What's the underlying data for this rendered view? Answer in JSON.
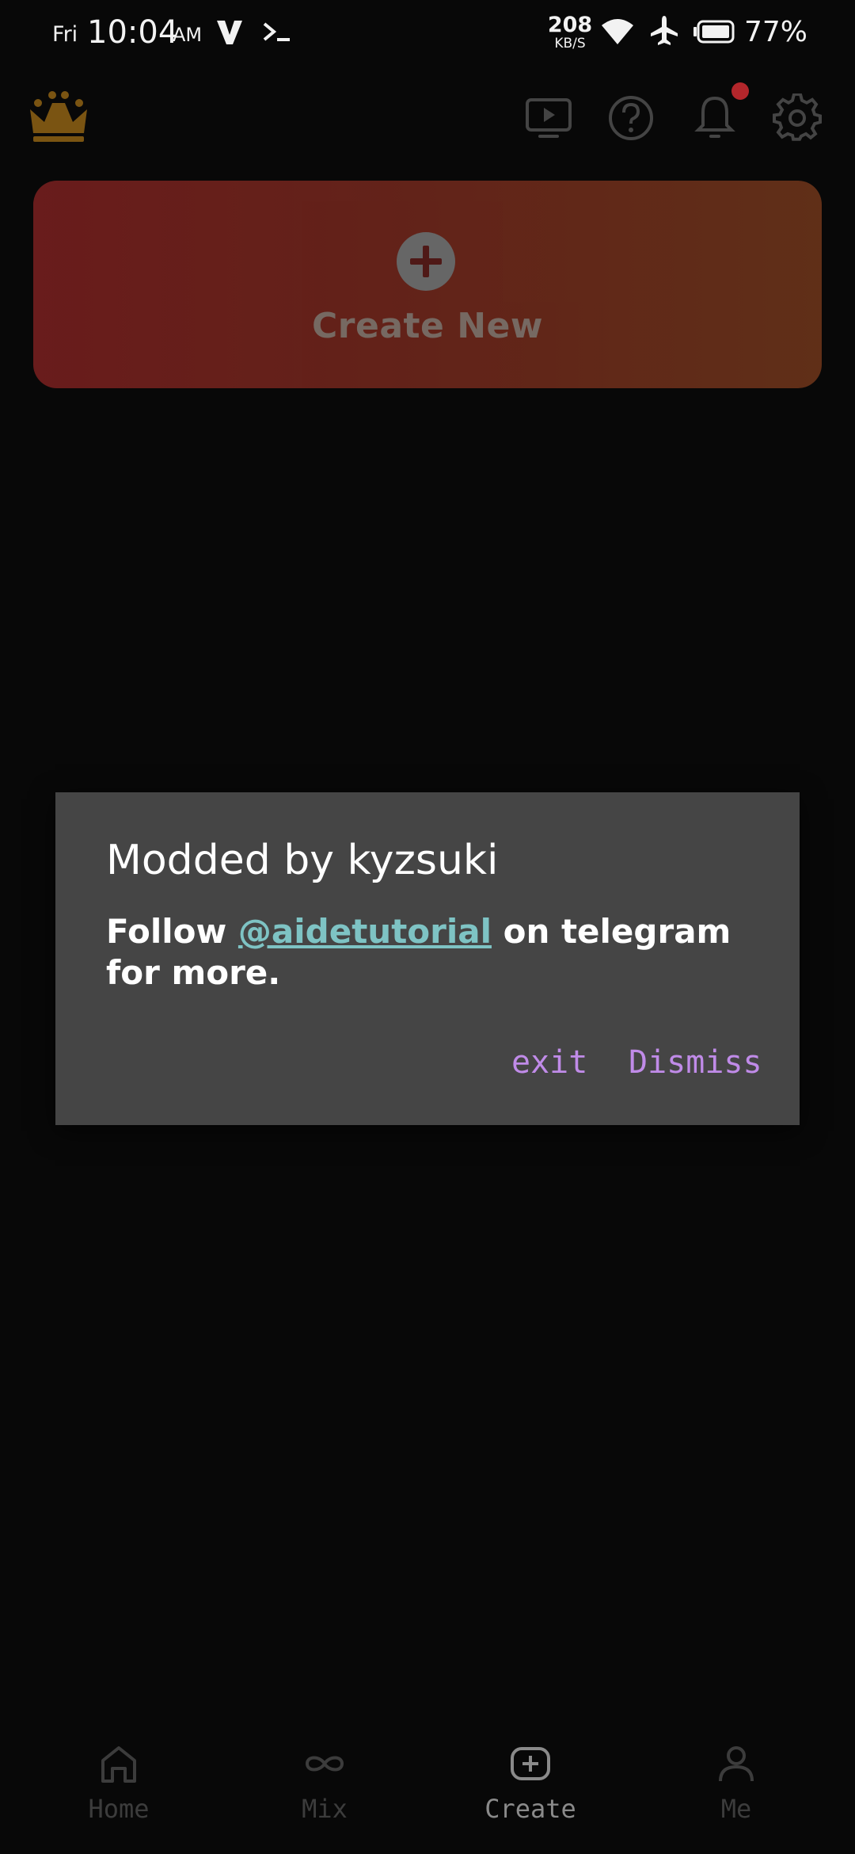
{
  "status_bar": {
    "day": "Fri",
    "time": "10:04",
    "ampm": "AM",
    "net_speed": "208",
    "net_unit": "KB/S",
    "battery": "77%",
    "icons": [
      "v-icon",
      "terminal-icon",
      "wifi-icon",
      "airplane-icon",
      "battery-icon"
    ]
  },
  "header": {
    "icons": [
      "crown-icon",
      "tv-play-icon",
      "help-icon",
      "bell-icon",
      "gear-icon"
    ],
    "notification_dot_color": "#b3262b"
  },
  "create_card": {
    "label": "Create New",
    "gradient_start": "#7a1f1f",
    "gradient_end": "#6f361a"
  },
  "dialog": {
    "title": "Modded by kyzsuki",
    "message_prefix": "Follow ",
    "link_text": "@aidetutorial",
    "message_suffix": " on telegram for more.",
    "buttons": {
      "exit": "exit",
      "dismiss": "Dismiss"
    },
    "button_color": "#c08be8",
    "link_color": "#7ec3c4"
  },
  "bottom_nav": {
    "items": [
      {
        "label": "Home",
        "icon": "home-icon"
      },
      {
        "label": "Mix",
        "icon": "infinity-icon"
      },
      {
        "label": "Create",
        "icon": "plus-box-icon"
      },
      {
        "label": "Me",
        "icon": "person-icon"
      }
    ],
    "active": "Create"
  }
}
